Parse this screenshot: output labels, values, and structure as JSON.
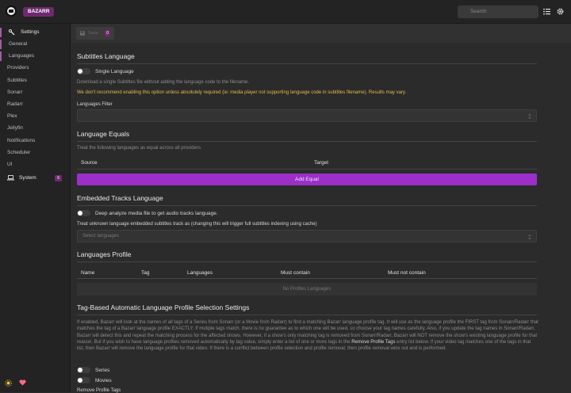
{
  "header": {
    "brand": "BAZARR",
    "search_placeholder": "Search"
  },
  "sidebar": {
    "settings_label": "Settings",
    "items": [
      "General",
      "Languages",
      "Providers",
      "Subtitles",
      "Sonarr",
      "Radarr",
      "Plex",
      "Jellyfin",
      "Notifications",
      "Scheduler",
      "UI"
    ],
    "system_label": "System",
    "system_badge": "6"
  },
  "toolbar": {
    "save_label": "Save",
    "save_count": "0"
  },
  "subtitles_language": {
    "title": "Subtitles Language",
    "single_language_label": "Single Language",
    "single_language_desc": "Download a single Subtitles file without adding the language code to the filename.",
    "warning": "We don't recommend enabling this option unless absolutely required (ie: media player not supporting language code in subtitles filename). Results may vary.",
    "filter_label": "Languages Filter"
  },
  "language_equals": {
    "title": "Language Equals",
    "desc": "Treat the following languages as equal across all providers.",
    "col_source": "Source",
    "col_target": "Target",
    "add_button": "Add Equal"
  },
  "embedded": {
    "title": "Embedded Tracks Language",
    "deep_analyze_label": "Deep analyze media file to get audio tracks language.",
    "unknown_label": "Treat unknown language embedded subtitles track as (changing this will trigger full subtitles indexing using cache)",
    "select_placeholder": "Select languages"
  },
  "profiles": {
    "title": "Languages Profile",
    "columns": [
      "Name",
      "Tag",
      "Languages",
      "Must contain",
      "Must not contain"
    ],
    "empty": "No Profiles Languages"
  },
  "tag_based": {
    "title": "Tag-Based Automatic Language Profile Selection Settings",
    "desc_1": "If enabled, Bazarr will look at the names of all tags of a Series from Sonarr (or a Movie from Radarr) to find a matching Bazarr language profile tag. It will use as the language profile the FIRST tag from Sonarr/Radarr that matches the tag of a Bazarr language profile EXACTLY. If mutiple tags match, there is no guarantee as to which one will be used, so choose your tag names carefully. Also, if you update the tag names in Sonarr/Radarr, Bazarr will detect this and repeat the matching process for the affected shows. However, if a show's only matching tag is removed from Sonarr/Radarr, Bazarr will NOT remove the show's existing language profile for that reason. But if you wish to have language profiles removed automatically by tag value, simply enter a list of one or more tags in the",
    "desc_bold": "Remove Profile Tags",
    "desc_2": "entry list below. If your video tag matches one of the tags in that list, then Bazarr will remove the language profile for that video. If there is a conflict between profile selection and profile removal, then profile removal wins out and is performed.",
    "series_label": "Series",
    "movies_label": "Movies",
    "remove_tags_label": "Remove Profile Tags"
  },
  "colors": {
    "accent": "#9b2fc7",
    "brand": "#6e2a6e",
    "warning": "#e8b84a"
  }
}
